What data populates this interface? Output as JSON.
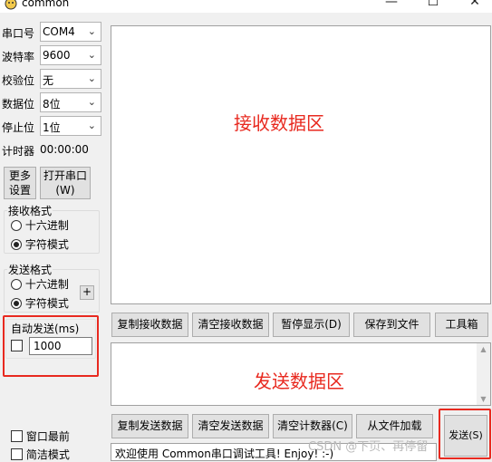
{
  "window": {
    "title": "common"
  },
  "left": {
    "port_label": "串口号",
    "port_value": "COM4",
    "baud_label": "波特率",
    "baud_value": "9600",
    "parity_label": "校验位",
    "parity_value": "无",
    "databits_label": "数据位",
    "databits_value": "8位",
    "stopbits_label": "停止位",
    "stopbits_value": "1位",
    "timer_label": "计时器",
    "timer_value": "00:00:00",
    "more_settings_line1": "更多",
    "more_settings_line2": "设置",
    "open_port_line1": "打开串口",
    "open_port_line2": "(W)",
    "recv_format_title": "接收格式",
    "recv_hex": "十六进制",
    "recv_char": "字符模式",
    "send_format_title": "发送格式",
    "send_hex": "十六进制",
    "send_char": "字符模式",
    "plus": "+",
    "auto_send_label": "自动发送(ms)",
    "auto_send_value": "1000",
    "window_top": "窗口最前",
    "simple_mode": "简洁模式"
  },
  "receive_area": {
    "label": "接收数据区"
  },
  "recv_toolbar": {
    "copy": "复制接收数据",
    "clear": "清空接收数据",
    "pause": "暂停显示(D)",
    "save": "保存到文件",
    "toolbox": "工具箱"
  },
  "send_area": {
    "label": "发送数据区"
  },
  "send_toolbar": {
    "copy": "复制发送数据",
    "clear": "清空发送数据",
    "clear_count": "清空计数器(C)",
    "load": "从文件加载",
    "send": "发送(S)"
  },
  "status": {
    "text": "欢迎使用 Common串口调试工具! Enjoy! :-)"
  },
  "watermark": "CSDN @下页、再停留",
  "colors": {
    "accent_red": "#e8291f"
  }
}
